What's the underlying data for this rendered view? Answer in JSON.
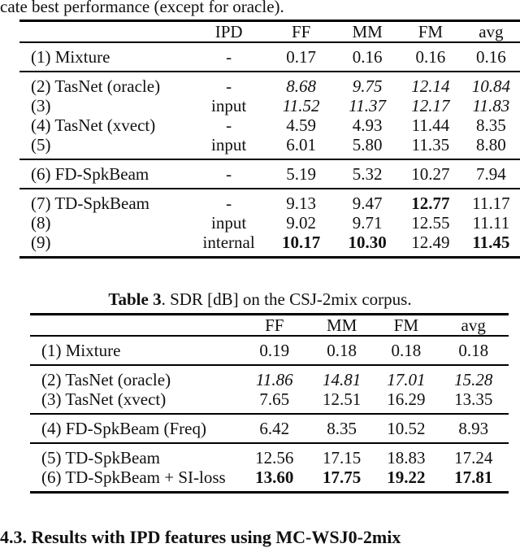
{
  "top_caption_fragment": "cate best performance (except for oracle).",
  "table2": {
    "headers": [
      "",
      "IPD",
      "FF",
      "MM",
      "FM",
      "avg"
    ],
    "groups": [
      [
        {
          "label": "(1) Mixture",
          "ipd": "-",
          "ff": "0.17",
          "mm": "0.16",
          "fm": "0.16",
          "avg": "0.16"
        }
      ],
      [
        {
          "label": "(2) TasNet (oracle)",
          "ipd": "-",
          "ff": "8.68",
          "mm": "9.75",
          "fm": "12.14",
          "avg": "10.84",
          "style": "italic"
        },
        {
          "label": "(3)",
          "ipd": "input",
          "ff": "11.52",
          "mm": "11.37",
          "fm": "12.17",
          "avg": "11.83",
          "style": "italic"
        },
        {
          "label": "(4) TasNet (xvect)",
          "ipd": "-",
          "ff": "4.59",
          "mm": "4.93",
          "fm": "11.44",
          "avg": "8.35"
        },
        {
          "label": "(5)",
          "ipd": "input",
          "ff": "6.01",
          "mm": "5.80",
          "fm": "11.35",
          "avg": "8.80"
        }
      ],
      [
        {
          "label": "(6) FD-SpkBeam",
          "ipd": "-",
          "ff": "5.19",
          "mm": "5.32",
          "fm": "10.27",
          "avg": "7.94"
        }
      ],
      [
        {
          "label": "(7) TD-SpkBeam",
          "ipd": "-",
          "ff": "9.13",
          "mm": "9.47",
          "fm": "12.77",
          "avg": "11.17",
          "bold": [
            "fm"
          ]
        },
        {
          "label": "(8)",
          "ipd": "input",
          "ff": "9.02",
          "mm": "9.71",
          "fm": "12.55",
          "avg": "11.11"
        },
        {
          "label": "(9)",
          "ipd": "internal",
          "ff": "10.17",
          "mm": "10.30",
          "fm": "12.49",
          "avg": "11.45",
          "bold": [
            "ff",
            "mm",
            "avg"
          ]
        }
      ]
    ]
  },
  "table3": {
    "caption_bold": "Table 3",
    "caption_rest": ". SDR [dB] on the CSJ-2mix corpus.",
    "headers": [
      "",
      "FF",
      "MM",
      "FM",
      "avg"
    ],
    "groups": [
      [
        {
          "label": "(1) Mixture",
          "ff": "0.19",
          "mm": "0.18",
          "fm": "0.18",
          "avg": "0.18"
        }
      ],
      [
        {
          "label": "(2) TasNet (oracle)",
          "ff": "11.86",
          "mm": "14.81",
          "fm": "17.01",
          "avg": "15.28",
          "style": "italic"
        },
        {
          "label": "(3) TasNet (xvect)",
          "ff": "7.65",
          "mm": "12.51",
          "fm": "16.29",
          "avg": "13.35"
        }
      ],
      [
        {
          "label": "(4) FD-SpkBeam (Freq)",
          "ff": "6.42",
          "mm": "8.35",
          "fm": "10.52",
          "avg": "8.93"
        }
      ],
      [
        {
          "label": "(5) TD-SpkBeam",
          "ff": "12.56",
          "mm": "17.15",
          "fm": "18.83",
          "avg": "17.24"
        },
        {
          "label": "(6) TD-SpkBeam + SI-loss",
          "ff": "13.60",
          "mm": "17.75",
          "fm": "19.22",
          "avg": "17.81",
          "bold": [
            "ff",
            "mm",
            "fm",
            "avg"
          ]
        }
      ]
    ]
  },
  "section_heading_fragment": "4.3.  Results with IPD features using MC-WSJ0-2mix"
}
